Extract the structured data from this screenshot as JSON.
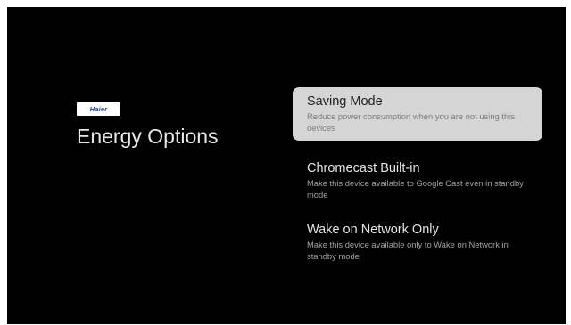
{
  "brand": {
    "logo_text": "Haier"
  },
  "page": {
    "title": "Energy Options"
  },
  "options": [
    {
      "title": "Saving Mode",
      "description": "Reduce power consumption when you are not using this devices",
      "focused": true
    },
    {
      "title": "Chromecast Built-in",
      "description": "Make this device available to Google Cast even in standby mode",
      "focused": false
    },
    {
      "title": "Wake on Network Only",
      "description": "Make this device available only to Wake on Network in standby mode",
      "focused": false
    }
  ],
  "colors": {
    "background": "#000000",
    "focus_highlight": "#d5d5d5",
    "brand_blue": "#1d3f9a"
  }
}
